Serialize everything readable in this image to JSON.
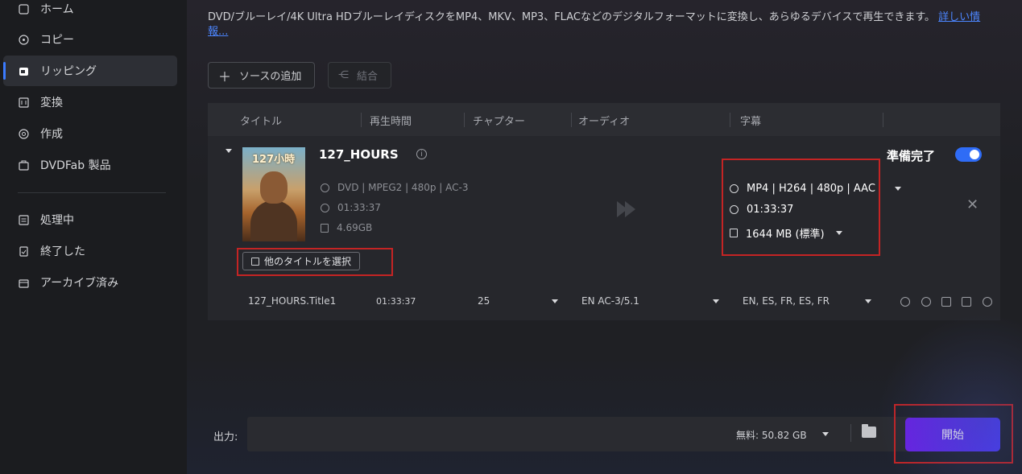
{
  "sidebar": {
    "items": [
      {
        "label": "ホーム",
        "icon": "home-icon"
      },
      {
        "label": "コピー",
        "icon": "copy-icon"
      },
      {
        "label": "リッピング",
        "icon": "ripper-icon",
        "active": true
      },
      {
        "label": "変換",
        "icon": "convert-icon"
      },
      {
        "label": "作成",
        "icon": "create-icon"
      },
      {
        "label": "DVDFab 製品",
        "icon": "products-icon"
      },
      {
        "label": "処理中",
        "icon": "processing-icon"
      },
      {
        "label": "終了した",
        "icon": "finished-icon"
      },
      {
        "label": "アーカイブ済み",
        "icon": "archive-icon"
      }
    ]
  },
  "main": {
    "description": "DVD/ブルーレイ/4K Ultra HDブルーレイディスクをMP4、MKV、MP3、FLACなどのデジタルフォーマットに変換し、あらゆるデバイスで再生できます。",
    "details_link": "詳しい情報...",
    "toolbar": {
      "add_source": "ソースの追加",
      "merge": "結合"
    },
    "table": {
      "headers": [
        "タイトル",
        "再生時間",
        "チャプター",
        "オーディオ",
        "字幕"
      ]
    },
    "item": {
      "poster_title": "127小時",
      "title": "127_HOURS",
      "source_format": "DVD | MPEG2 | 480p | AC-3",
      "source_duration": "01:33:37",
      "source_size": "4.69GB",
      "output_format": "MP4 | H264 | 480p | AAC",
      "output_duration": "01:33:37",
      "output_size": "1644 MB (標準)",
      "ready_label": "準備完了",
      "ready_toggle_on": true,
      "select_other_title": "他のタイトルを選択",
      "row": {
        "title": "127_HOURS.Title1",
        "duration": "01:33:37",
        "chapters": "25",
        "audio": "EN  AC-3/5.1",
        "subtitles": "EN, ES, FR, ES, FR"
      }
    },
    "output": {
      "label": "出力:",
      "free_space": "無料:  50.82 GB",
      "start": "開始"
    }
  },
  "colors": {
    "accent": "#2f6cf6",
    "start_gradient_from": "#6a22e6",
    "start_gradient_to": "#4a3cf8",
    "highlight_box": "#c42424"
  }
}
